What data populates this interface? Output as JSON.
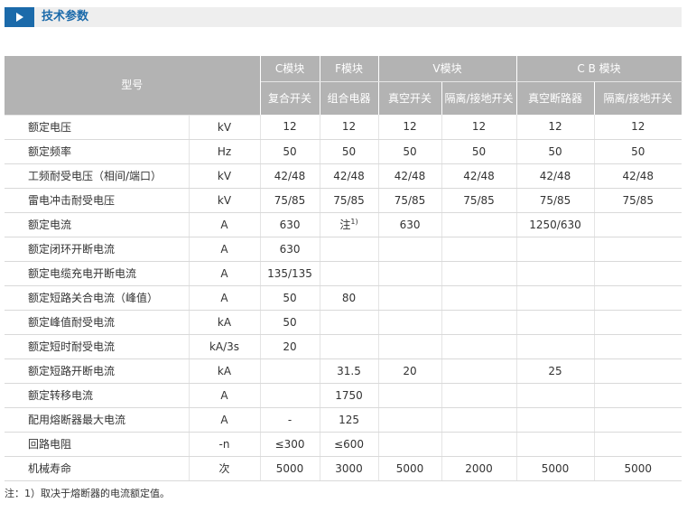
{
  "section": {
    "title": "技术参数"
  },
  "table": {
    "model_header": "型号",
    "groups": [
      {
        "label": "C模块",
        "subs": [
          "复合开关"
        ]
      },
      {
        "label": "F模块",
        "subs": [
          "组合电器"
        ]
      },
      {
        "label": "V模块",
        "subs": [
          "真空开关",
          "隔离/接地开关"
        ]
      },
      {
        "label": "C B 模块",
        "subs": [
          "真空断路器",
          "隔离/接地开关"
        ]
      }
    ],
    "rows": [
      {
        "param": "额定电压",
        "unit": "kV",
        "values": [
          "12",
          "12",
          "12",
          "12",
          "12",
          "12"
        ]
      },
      {
        "param": "额定频率",
        "unit": "Hz",
        "values": [
          "50",
          "50",
          "50",
          "50",
          "50",
          "50"
        ]
      },
      {
        "param": "工频耐受电压（相间/端口）",
        "unit": "kV",
        "values": [
          "42/48",
          "42/48",
          "42/48",
          "42/48",
          "42/48",
          "42/48"
        ]
      },
      {
        "param": "雷电冲击耐受电压",
        "unit": "kV",
        "values": [
          "75/85",
          "75/85",
          "75/85",
          "75/85",
          "75/85",
          "75/85"
        ]
      },
      {
        "param": "额定电流",
        "unit": "A",
        "values": [
          "630",
          "注",
          "630",
          "",
          "1250/630",
          ""
        ],
        "sup_col": 1,
        "sup": "1)"
      },
      {
        "param": "额定闭环开断电流",
        "unit": "A",
        "values": [
          "630",
          "",
          "",
          "",
          "",
          ""
        ]
      },
      {
        "param": "额定电缆充电开断电流",
        "unit": "A",
        "values": [
          "135/135",
          "",
          "",
          "",
          "",
          ""
        ]
      },
      {
        "param": "额定短路关合电流（峰值）",
        "unit": "A",
        "values": [
          "50",
          "80",
          "",
          "",
          "",
          ""
        ]
      },
      {
        "param": "额定峰值耐受电流",
        "unit": "kA",
        "values": [
          "50",
          "",
          "",
          "",
          "",
          ""
        ]
      },
      {
        "param": "额定短时耐受电流",
        "unit": "kA/3s",
        "values": [
          "20",
          "",
          "",
          "",
          "",
          ""
        ]
      },
      {
        "param": "额定短路开断电流",
        "unit": "kA",
        "values": [
          "",
          "31.5",
          "20",
          "",
          "25",
          ""
        ]
      },
      {
        "param": "额定转移电流",
        "unit": "A",
        "values": [
          "",
          "1750",
          "",
          "",
          "",
          ""
        ]
      },
      {
        "param": "配用熔断器最大电流",
        "unit": "A",
        "values": [
          "-",
          "125",
          "",
          "",
          "",
          ""
        ]
      },
      {
        "param": "回路电阻",
        "unit": "-n",
        "values": [
          "≤300",
          "≤600",
          "",
          "",
          "",
          ""
        ]
      },
      {
        "param": "机械寿命",
        "unit": "次",
        "values": [
          "5000",
          "3000",
          "5000",
          "2000",
          "5000",
          "5000"
        ]
      }
    ]
  },
  "footnote": "注：1）取决于熔断器的电流额定值。"
}
